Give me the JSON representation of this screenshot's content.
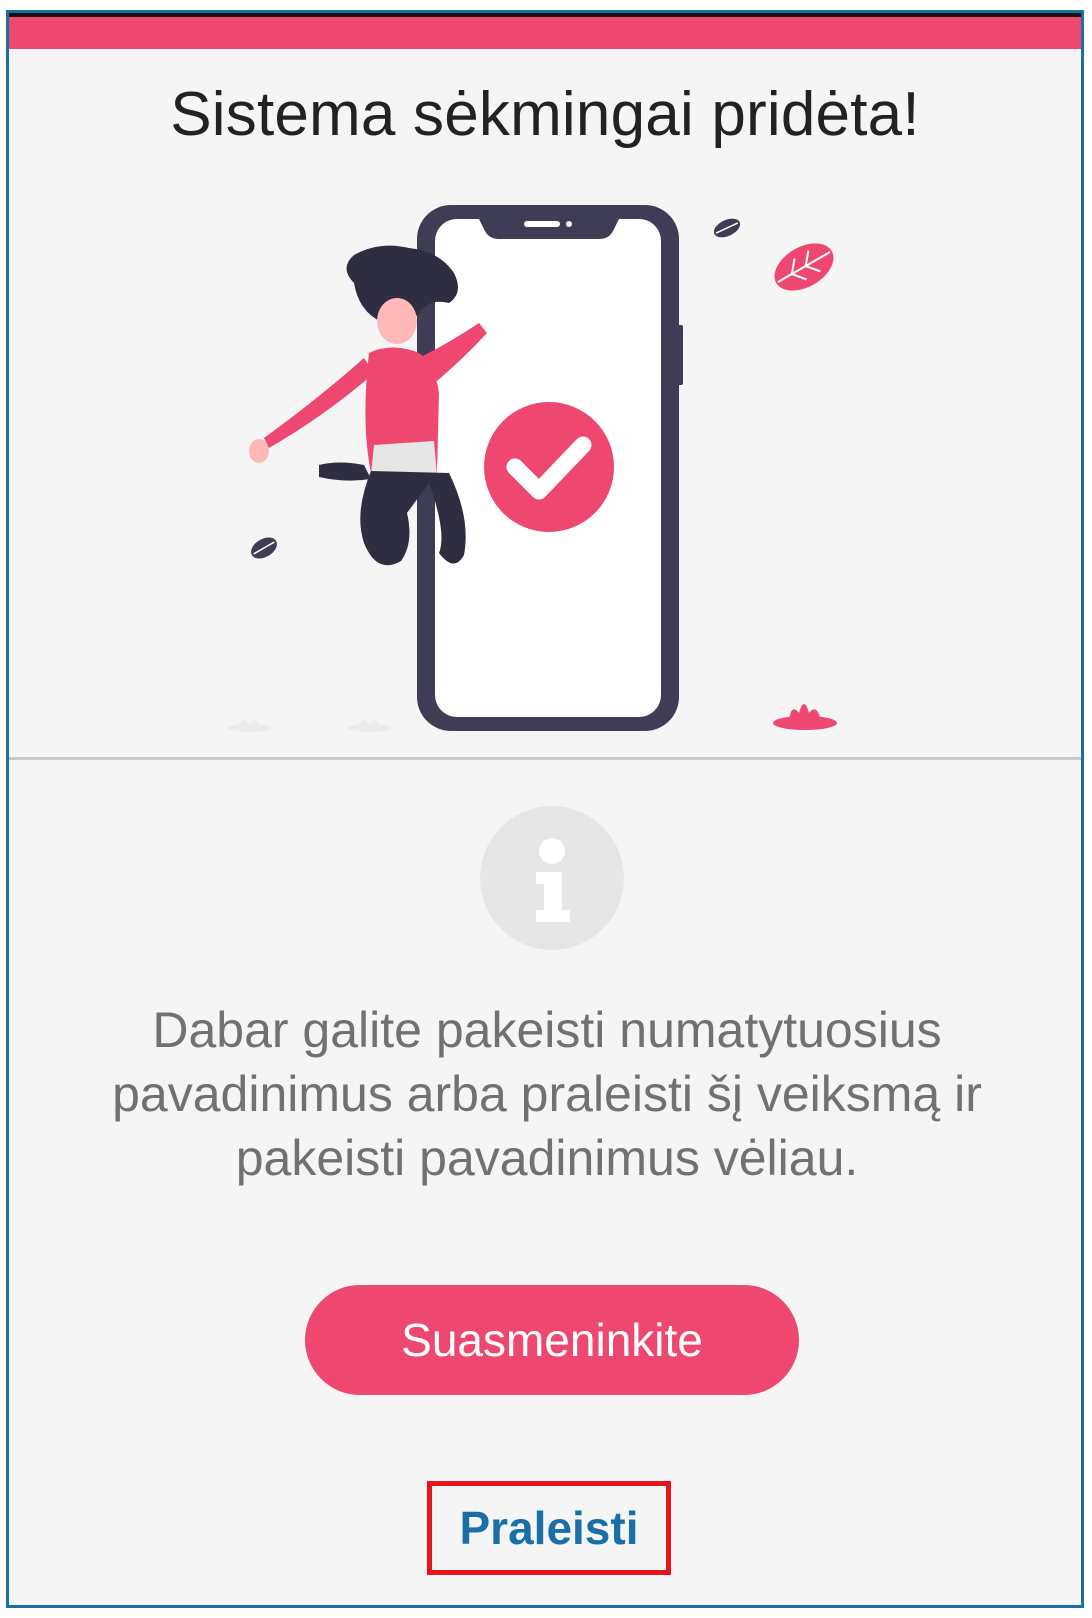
{
  "title": "Sistema sėkmingai pridėta!",
  "description_lines": [
    "Dabar galite pakeisti numatytuosius",
    "pavadinimus arba praleisti šį veiksmą ir",
    "pakeisti pavadinimus vėliau."
  ],
  "buttons": {
    "personalize_label": "Suasmeninkite",
    "skip_label": "Praleisti"
  },
  "icons": {
    "hero": "success-illustration-icon",
    "info": "info-icon"
  },
  "colors": {
    "accent": "#ee4770",
    "link": "#1a6fa6",
    "highlight_outline": "#e8141b",
    "background": "#f5f5f5"
  }
}
